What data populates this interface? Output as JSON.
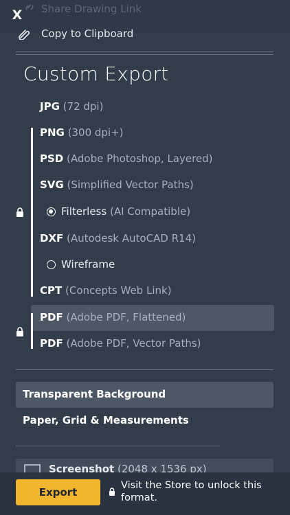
{
  "header": {
    "close_label": "X",
    "share_label": "Share Drawing Link",
    "clipboard_label": "Copy to Clipboard"
  },
  "section_title": "Custom Export",
  "formats": [
    {
      "name": "JPG",
      "desc": "(72 dpi)"
    },
    {
      "name": "PNG",
      "desc": "(300 dpi+)"
    },
    {
      "name": "PSD",
      "desc": "(Adobe Photoshop, Layered)"
    },
    {
      "name": "SVG",
      "desc": "(Simplified Vector Paths)"
    },
    {
      "name": "Filterless",
      "desc": "(AI Compatible)",
      "selected": true
    },
    {
      "name": "DXF",
      "desc": "(Autodesk AutoCAD R14)"
    },
    {
      "name": "Wireframe",
      "selected": false
    },
    {
      "name": "CPT",
      "desc": "(Concepts Web Link)"
    },
    {
      "name": "PDF",
      "desc": "(Adobe PDF, Flattened)",
      "highlighted": true
    },
    {
      "name": "PDF",
      "desc": "(Adobe PDF, Vector Paths)"
    }
  ],
  "background_options": [
    {
      "label": "Transparent Background",
      "selected": true
    },
    {
      "label": "Paper, Grid & Measurements",
      "selected": false
    }
  ],
  "screenshot": {
    "label": "Screenshot",
    "size": "(2048 x 1536 px)"
  },
  "footer": {
    "export_label": "Export",
    "unlock_message": "Visit the Store to unlock this format."
  },
  "colors": {
    "background": "#323c4a",
    "highlight": "#4d5766",
    "accent": "#f2b52e"
  }
}
